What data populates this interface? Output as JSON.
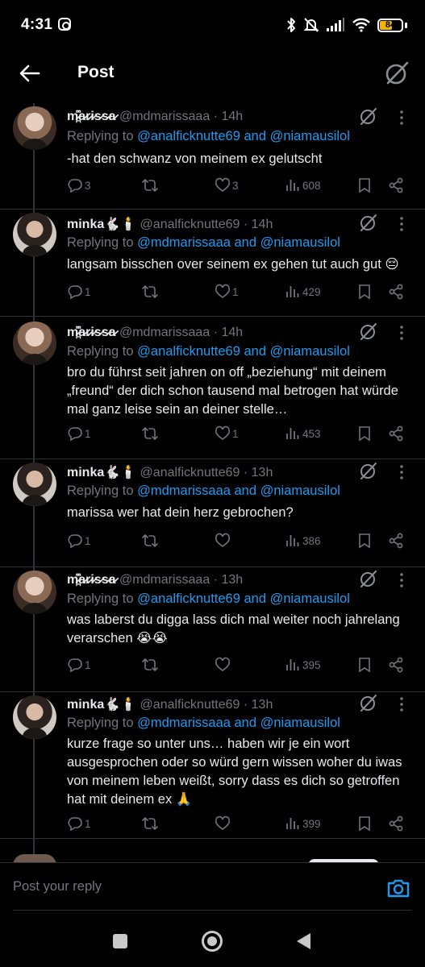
{
  "status_bar": {
    "time": "4:31",
    "battery": "84"
  },
  "header": {
    "title": "Post"
  },
  "reply_bar": {
    "placeholder": "Post your reply"
  },
  "tweets": [
    {
      "name": "m̷̪͆̽a̷r̷i̷s̷s̷a̷",
      "handle": "@mdmarissaaa",
      "time": "· 14h",
      "replying_prefix": "Replying to ",
      "replying_to": "@analficknutte69 and @niamausilol",
      "text": "-hat den schwanz von meinem ex gelutscht",
      "replies": "3",
      "reposts": "",
      "likes": "3",
      "views": "608"
    },
    {
      "name": "minka🐇🕯️",
      "handle": "@analficknutte69",
      "time": "· 14h",
      "replying_prefix": "Replying to ",
      "replying_to": "@mdmarissaaa and @niamausilol",
      "text": "langsam bisschen over seinem ex gehen tut auch gut 😔",
      "replies": "1",
      "reposts": "",
      "likes": "1",
      "views": "429"
    },
    {
      "name": "m̷̪͆̽a̷r̷i̷s̷s̷a̷",
      "handle": "@mdmarissaaa",
      "time": "· 14h",
      "replying_prefix": "Replying to ",
      "replying_to": "@analficknutte69 and @niamausilol",
      "text": "bro du führst seit jahren on off „beziehung“ mit deinem „freund“ der dich schon tausend mal betrogen hat würde mal ganz leise sein an deiner stelle…",
      "replies": "1",
      "reposts": "",
      "likes": "1",
      "views": "453"
    },
    {
      "name": "minka🐇🕯️",
      "handle": "@analficknutte69",
      "time": "· 13h",
      "replying_prefix": "Replying to ",
      "replying_to": "@mdmarissaaa and @niamausilol",
      "text": "marissa wer hat dein herz gebrochen?",
      "replies": "1",
      "reposts": "",
      "likes": "",
      "views": "386"
    },
    {
      "name": "m̷̪͆̽a̷r̷i̷s̷s̷a̷",
      "handle": "@mdmarissaaa",
      "time": "· 13h",
      "replying_prefix": "Replying to ",
      "replying_to": "@analficknutte69 and @niamausilol",
      "text": "was laberst du digga lass dich mal weiter noch jahrelang verarschen 😭😭",
      "replies": "1",
      "reposts": "",
      "likes": "",
      "views": "395"
    },
    {
      "name": "minka🐇🕯️",
      "handle": "@analficknutte69",
      "time": "· 13h",
      "replying_prefix": "Replying to ",
      "replying_to": "@mdmarissaaa and @niamausilol",
      "text": "kurze frage so unter uns… haben wir je ein wort ausgesprochen oder so würd gern wissen woher du iwas von meinem leben weißt, sorry dass es dich so getroffen hat mit deinem ex 🙏",
      "replies": "1",
      "reposts": "",
      "likes": "",
      "views": "399"
    }
  ],
  "icons": [
    "back-arrow-icon",
    "grok-icon",
    "more-icon",
    "reply-icon",
    "repost-icon",
    "like-icon",
    "views-icon",
    "bookmark-icon",
    "share-icon",
    "camera-icon"
  ],
  "colors": {
    "accent": "#1d9bf0",
    "muted": "#71767b",
    "text": "#e7e9ea",
    "background": "#000000"
  }
}
